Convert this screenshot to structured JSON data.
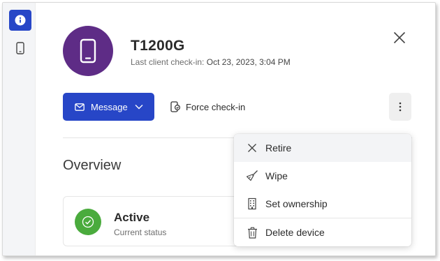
{
  "device": {
    "name": "T1200G",
    "checkin_label": "Last client check-in:",
    "checkin_time": "Oct 23, 2023, 3:04 PM"
  },
  "actions": {
    "message_label": "Message",
    "force_checkin_label": "Force check-in"
  },
  "overview": {
    "heading": "Overview",
    "status_value": "Active",
    "status_caption": "Current status"
  },
  "more_menu": {
    "items": [
      {
        "label": "Retire",
        "icon": "close-icon"
      },
      {
        "label": "Wipe",
        "icon": "broom-icon"
      },
      {
        "label": "Set ownership",
        "icon": "building-icon"
      },
      {
        "label": "Delete device",
        "icon": "trash-icon"
      }
    ]
  },
  "colors": {
    "primary": "#2746c7",
    "avatar": "#5e2c86",
    "status_ok": "#4aab3d"
  }
}
